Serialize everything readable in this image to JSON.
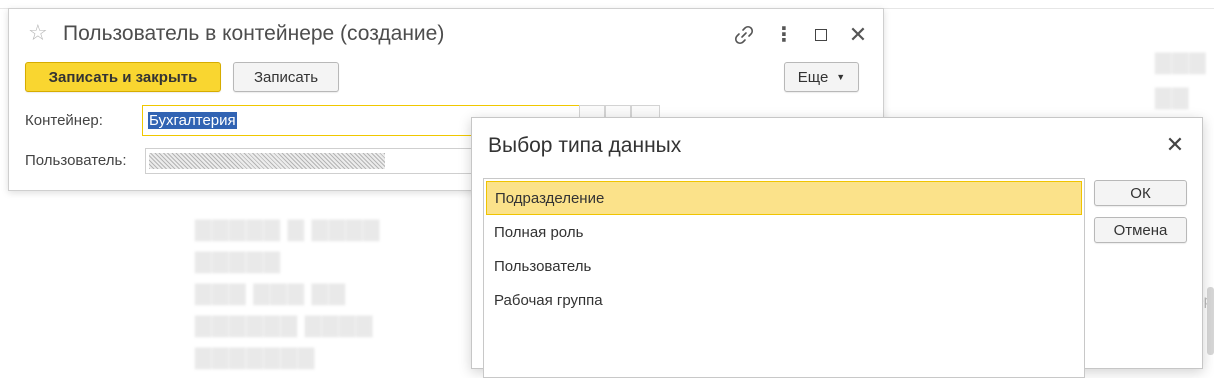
{
  "form": {
    "title": "Пользователь в контейнере (создание)",
    "toolbar": {
      "save_close_label": "Записать и закрыть",
      "save_label": "Записать",
      "more_label": "Еще"
    },
    "fields": {
      "container_label": "Контейнер:",
      "container_value": "Бухгалтерия",
      "user_label": "Пользователь:"
    }
  },
  "dialog": {
    "title": "Выбор типа данных",
    "items": [
      {
        "label": "Подразделение",
        "selected": true
      },
      {
        "label": "Полная роль",
        "selected": false
      },
      {
        "label": "Пользователь",
        "selected": false
      },
      {
        "label": "Рабочая группа",
        "selected": false
      }
    ],
    "ok_label": "ОК",
    "cancel_label": "Отмена"
  },
  "background": {
    "peek_text": "ер"
  },
  "colors": {
    "primary_button": "#f9d630",
    "selection_highlight": "#fbe28a",
    "text_selection": "#3163b3"
  }
}
